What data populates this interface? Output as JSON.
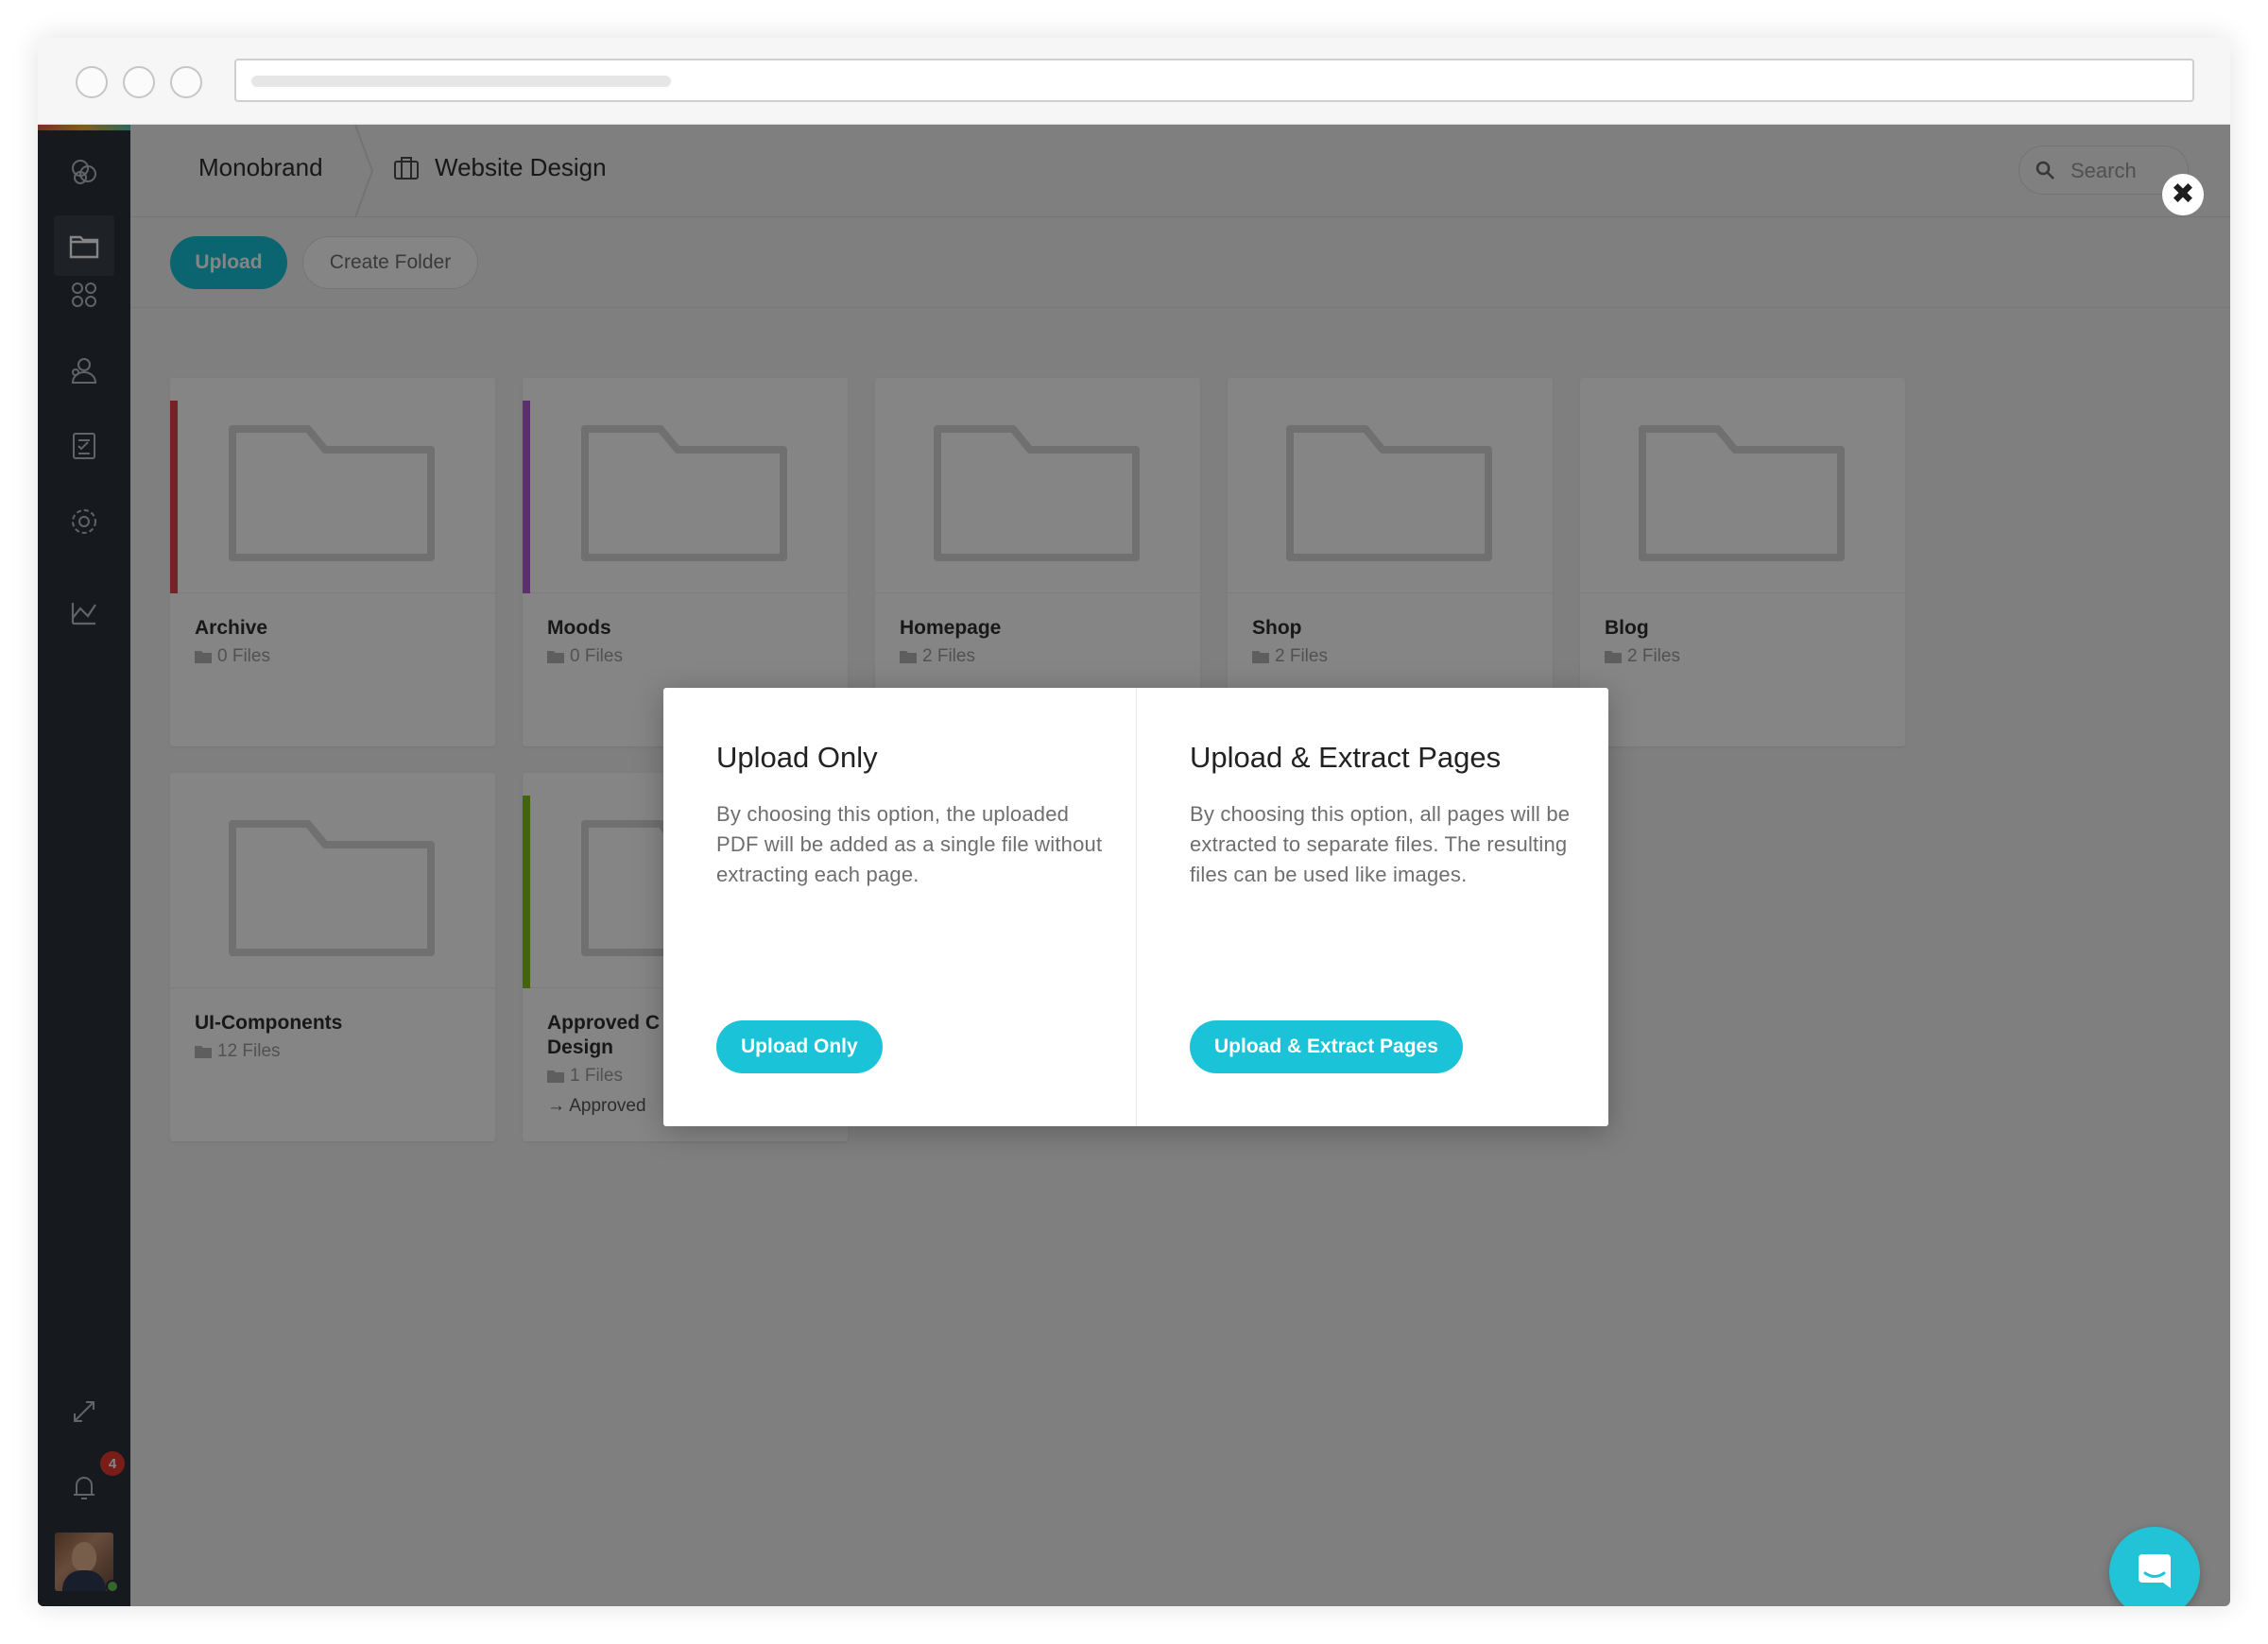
{
  "browser": {
    "address_bar": ""
  },
  "breadcrumb": {
    "root": "Monobrand",
    "project": "Website Design"
  },
  "search": {
    "placeholder": "Search"
  },
  "toolbar": {
    "upload_label": "Upload",
    "create_folder_label": "Create Folder"
  },
  "folders": [
    {
      "title": "Archive",
      "files": "0 Files",
      "stripe_color": "#e2444e"
    },
    {
      "title": "Moods",
      "files": "0 Files",
      "stripe_color": "#b25bd1"
    },
    {
      "title": "Homepage",
      "files": "2 Files",
      "stripe_color": ""
    },
    {
      "title": "Shop",
      "files": "2 Files",
      "stripe_color": ""
    },
    {
      "title": "Blog",
      "files": "2 Files",
      "stripe_color": ""
    },
    {
      "title": "UI-Components",
      "files": "12 Files",
      "stripe_color": ""
    },
    {
      "title": "Approved C\nDesign",
      "files": "1 Files",
      "status": "→ Approved",
      "stripe_color": "#7dc11a"
    }
  ],
  "sidebar": {
    "notification_count": "4"
  },
  "modal": {
    "upload_only": {
      "title": "Upload Only",
      "description": "By choosing this option, the uploaded PDF will be added as a single file without extracting each page.",
      "button_label": "Upload Only"
    },
    "upload_extract": {
      "title": "Upload & Extract Pages",
      "description": "By choosing this option, all pages will be extracted to separate files. The resulting files can be used like images.",
      "button_label": "Upload & Extract Pages"
    }
  },
  "colors": {
    "accent": "#1ac3d7",
    "sidebar": "#2b3139"
  }
}
